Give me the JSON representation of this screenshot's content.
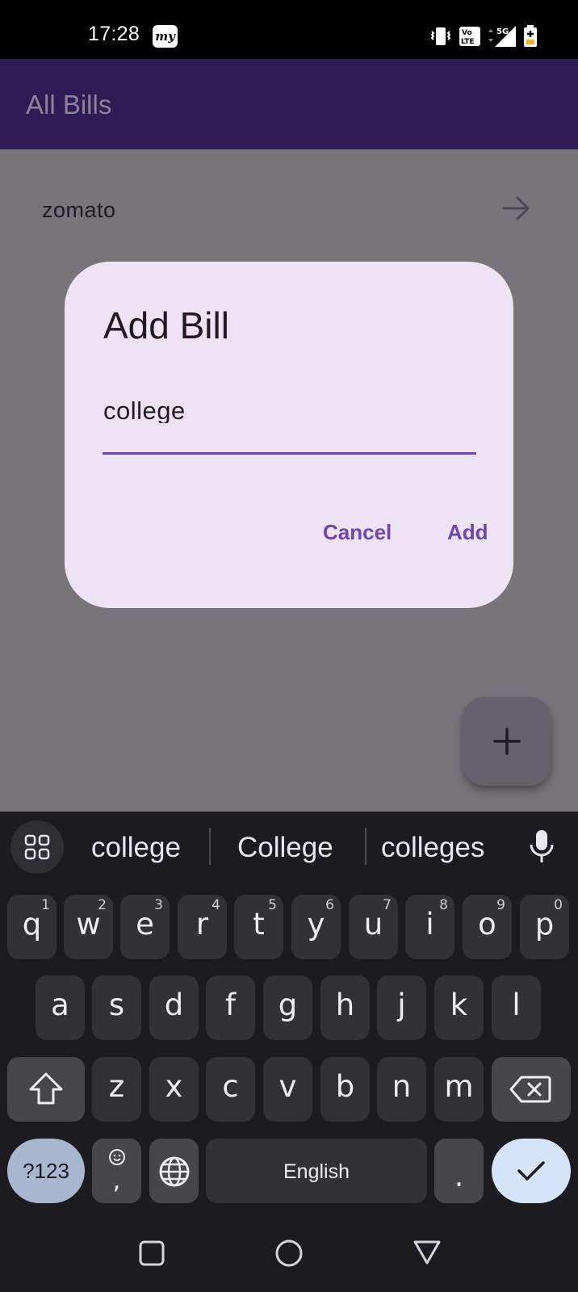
{
  "status_bar": {
    "time": "17:28",
    "app_icon_text": "my",
    "icons": [
      "vibrate-icon",
      "volte-icon",
      "signal-5g-icon",
      "battery-charging-icon"
    ],
    "network_label": "5G"
  },
  "app_bar": {
    "title": "All Bills"
  },
  "list": {
    "items": [
      {
        "label": "zomato",
        "icon": "arrow-right-icon"
      }
    ]
  },
  "fab": {
    "icon": "plus-icon"
  },
  "dialog": {
    "title": "Add Bill",
    "input_value": "college",
    "cancel_label": "Cancel",
    "add_label": "Add",
    "accent_color": "#6f45b3"
  },
  "keyboard": {
    "suggestions": [
      "college",
      "College",
      "colleges"
    ],
    "row1": [
      {
        "key": "q",
        "hint": "1"
      },
      {
        "key": "w",
        "hint": "2"
      },
      {
        "key": "e",
        "hint": "3"
      },
      {
        "key": "r",
        "hint": "4"
      },
      {
        "key": "t",
        "hint": "5"
      },
      {
        "key": "y",
        "hint": "6"
      },
      {
        "key": "u",
        "hint": "7"
      },
      {
        "key": "i",
        "hint": "8"
      },
      {
        "key": "o",
        "hint": "9"
      },
      {
        "key": "p",
        "hint": "0"
      }
    ],
    "row2": [
      "a",
      "s",
      "d",
      "f",
      "g",
      "h",
      "j",
      "k",
      "l"
    ],
    "row3": [
      "z",
      "x",
      "c",
      "v",
      "b",
      "n",
      "m"
    ],
    "symbols_label": "?123",
    "comma_label": ",",
    "space_label": "English",
    "period_label": "."
  },
  "nav_bar": {
    "icons": [
      "recents-square-icon",
      "home-circle-icon",
      "back-triangle-icon"
    ]
  }
}
